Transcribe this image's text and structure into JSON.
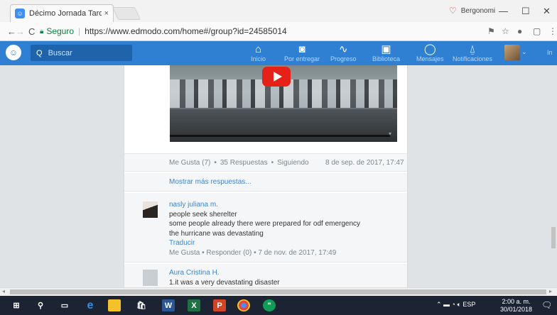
{
  "browser": {
    "tab_title": "Décimo Jornada Tarde | E",
    "tab_close": "×",
    "profile_label": "Bergonomi",
    "win_min": "—",
    "win_max": "☐",
    "win_close": "✕",
    "back": "←",
    "forward": "→",
    "reload": "C",
    "secure_label": "Seguro",
    "url": "https://www.edmodo.com/home#/group?id=24585014"
  },
  "app": {
    "logo": "☺",
    "search_placeholder": "Buscar",
    "nav": [
      {
        "label": "Inicio",
        "icon": "⌂"
      },
      {
        "label": "Por entregar",
        "icon": "◙"
      },
      {
        "label": "Progreso",
        "icon": "∿"
      },
      {
        "label": "Biblioteca",
        "icon": "▣"
      },
      {
        "label": "Mensajes",
        "icon": "◯"
      },
      {
        "label": "Notificaciones",
        "icon": "⍙"
      }
    ],
    "trailing": "In"
  },
  "post": {
    "likes": "Me Gusta (7)",
    "replies": "35 Respuestas",
    "following": "Siguiendo",
    "date": "8 de sep. de 2017, 17:47",
    "show_more": "Mostrar más respuestas..."
  },
  "comments": [
    {
      "name": "nasly juliana m.",
      "lines": [
        "people seek sherelter",
        "some people already there were prepared for odf emergency",
        "the hurricane was devastating"
      ],
      "translate": "Traducir",
      "meta": "Me Gusta  •  Responder (0)  •  7 de nov. de 2017, 17:49"
    },
    {
      "name": "Aura Cristina H.",
      "lines": [
        "1.it was a very devastating disaster"
      ]
    }
  ],
  "taskbar": {
    "lang": "ESP",
    "time": "2:00 a. m.",
    "date": "30/01/2018"
  }
}
